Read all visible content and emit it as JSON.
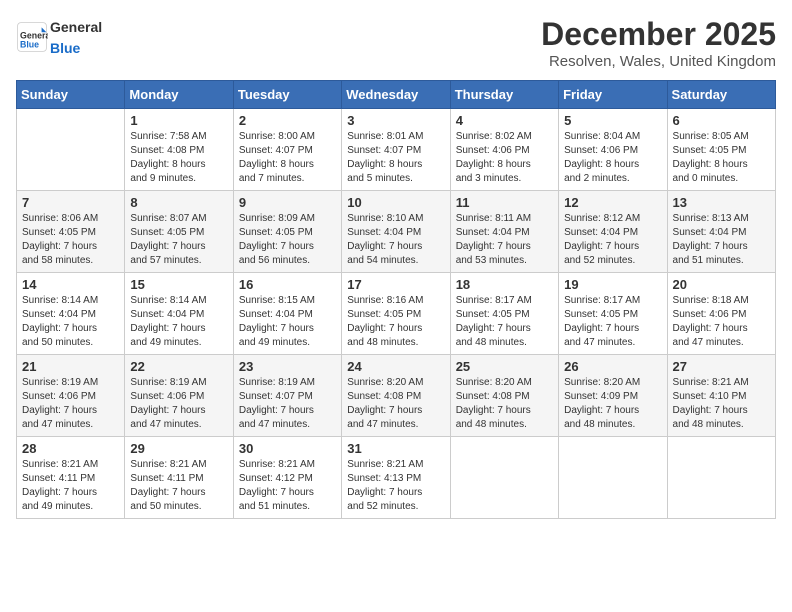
{
  "header": {
    "logo_general": "General",
    "logo_blue": "Blue",
    "month_title": "December 2025",
    "location": "Resolven, Wales, United Kingdom"
  },
  "days_of_week": [
    "Sunday",
    "Monday",
    "Tuesday",
    "Wednesday",
    "Thursday",
    "Friday",
    "Saturday"
  ],
  "weeks": [
    [
      {
        "day": "",
        "info": ""
      },
      {
        "day": "1",
        "info": "Sunrise: 7:58 AM\nSunset: 4:08 PM\nDaylight: 8 hours\nand 9 minutes."
      },
      {
        "day": "2",
        "info": "Sunrise: 8:00 AM\nSunset: 4:07 PM\nDaylight: 8 hours\nand 7 minutes."
      },
      {
        "day": "3",
        "info": "Sunrise: 8:01 AM\nSunset: 4:07 PM\nDaylight: 8 hours\nand 5 minutes."
      },
      {
        "day": "4",
        "info": "Sunrise: 8:02 AM\nSunset: 4:06 PM\nDaylight: 8 hours\nand 3 minutes."
      },
      {
        "day": "5",
        "info": "Sunrise: 8:04 AM\nSunset: 4:06 PM\nDaylight: 8 hours\nand 2 minutes."
      },
      {
        "day": "6",
        "info": "Sunrise: 8:05 AM\nSunset: 4:05 PM\nDaylight: 8 hours\nand 0 minutes."
      }
    ],
    [
      {
        "day": "7",
        "info": "Sunrise: 8:06 AM\nSunset: 4:05 PM\nDaylight: 7 hours\nand 58 minutes."
      },
      {
        "day": "8",
        "info": "Sunrise: 8:07 AM\nSunset: 4:05 PM\nDaylight: 7 hours\nand 57 minutes."
      },
      {
        "day": "9",
        "info": "Sunrise: 8:09 AM\nSunset: 4:05 PM\nDaylight: 7 hours\nand 56 minutes."
      },
      {
        "day": "10",
        "info": "Sunrise: 8:10 AM\nSunset: 4:04 PM\nDaylight: 7 hours\nand 54 minutes."
      },
      {
        "day": "11",
        "info": "Sunrise: 8:11 AM\nSunset: 4:04 PM\nDaylight: 7 hours\nand 53 minutes."
      },
      {
        "day": "12",
        "info": "Sunrise: 8:12 AM\nSunset: 4:04 PM\nDaylight: 7 hours\nand 52 minutes."
      },
      {
        "day": "13",
        "info": "Sunrise: 8:13 AM\nSunset: 4:04 PM\nDaylight: 7 hours\nand 51 minutes."
      }
    ],
    [
      {
        "day": "14",
        "info": "Sunrise: 8:14 AM\nSunset: 4:04 PM\nDaylight: 7 hours\nand 50 minutes."
      },
      {
        "day": "15",
        "info": "Sunrise: 8:14 AM\nSunset: 4:04 PM\nDaylight: 7 hours\nand 49 minutes."
      },
      {
        "day": "16",
        "info": "Sunrise: 8:15 AM\nSunset: 4:04 PM\nDaylight: 7 hours\nand 49 minutes."
      },
      {
        "day": "17",
        "info": "Sunrise: 8:16 AM\nSunset: 4:05 PM\nDaylight: 7 hours\nand 48 minutes."
      },
      {
        "day": "18",
        "info": "Sunrise: 8:17 AM\nSunset: 4:05 PM\nDaylight: 7 hours\nand 48 minutes."
      },
      {
        "day": "19",
        "info": "Sunrise: 8:17 AM\nSunset: 4:05 PM\nDaylight: 7 hours\nand 47 minutes."
      },
      {
        "day": "20",
        "info": "Sunrise: 8:18 AM\nSunset: 4:06 PM\nDaylight: 7 hours\nand 47 minutes."
      }
    ],
    [
      {
        "day": "21",
        "info": "Sunrise: 8:19 AM\nSunset: 4:06 PM\nDaylight: 7 hours\nand 47 minutes."
      },
      {
        "day": "22",
        "info": "Sunrise: 8:19 AM\nSunset: 4:06 PM\nDaylight: 7 hours\nand 47 minutes."
      },
      {
        "day": "23",
        "info": "Sunrise: 8:19 AM\nSunset: 4:07 PM\nDaylight: 7 hours\nand 47 minutes."
      },
      {
        "day": "24",
        "info": "Sunrise: 8:20 AM\nSunset: 4:08 PM\nDaylight: 7 hours\nand 47 minutes."
      },
      {
        "day": "25",
        "info": "Sunrise: 8:20 AM\nSunset: 4:08 PM\nDaylight: 7 hours\nand 48 minutes."
      },
      {
        "day": "26",
        "info": "Sunrise: 8:20 AM\nSunset: 4:09 PM\nDaylight: 7 hours\nand 48 minutes."
      },
      {
        "day": "27",
        "info": "Sunrise: 8:21 AM\nSunset: 4:10 PM\nDaylight: 7 hours\nand 48 minutes."
      }
    ],
    [
      {
        "day": "28",
        "info": "Sunrise: 8:21 AM\nSunset: 4:11 PM\nDaylight: 7 hours\nand 49 minutes."
      },
      {
        "day": "29",
        "info": "Sunrise: 8:21 AM\nSunset: 4:11 PM\nDaylight: 7 hours\nand 50 minutes."
      },
      {
        "day": "30",
        "info": "Sunrise: 8:21 AM\nSunset: 4:12 PM\nDaylight: 7 hours\nand 51 minutes."
      },
      {
        "day": "31",
        "info": "Sunrise: 8:21 AM\nSunset: 4:13 PM\nDaylight: 7 hours\nand 52 minutes."
      },
      {
        "day": "",
        "info": ""
      },
      {
        "day": "",
        "info": ""
      },
      {
        "day": "",
        "info": ""
      }
    ]
  ]
}
